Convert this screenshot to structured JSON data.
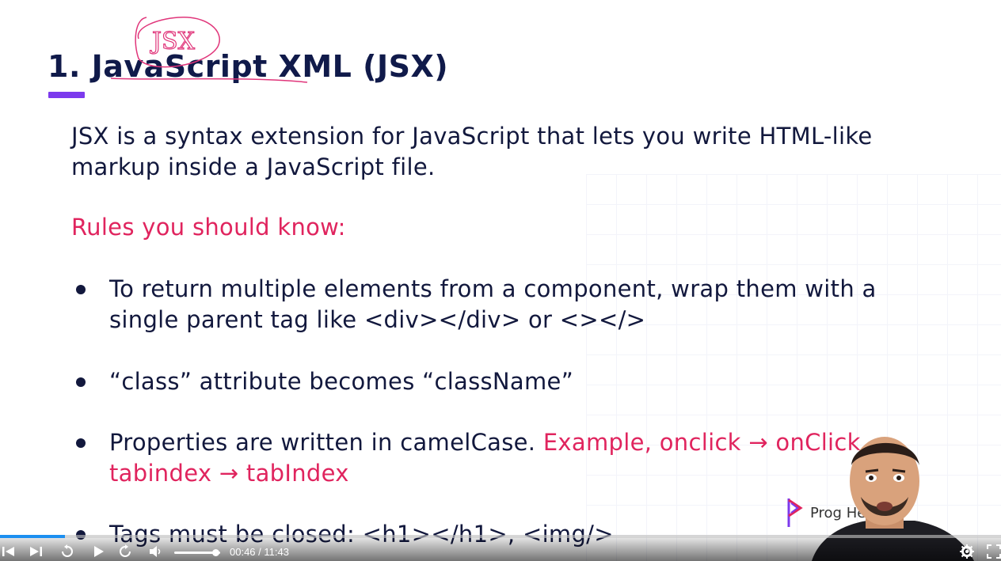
{
  "slide": {
    "title": "1. JavaScript XML (JSX)",
    "handwritten_note": "JSX",
    "intro": "JSX is a syntax extension for JavaScript that lets you write HTML-like markup inside a JavaScript file.",
    "rules_heading": "Rules you should know:",
    "rules": [
      {
        "text": "To return multiple elements from a component, wrap them with a single parent tag like <div></div> or <></>",
        "highlight": ""
      },
      {
        "text": "“class” attribute becomes “className”",
        "highlight": ""
      },
      {
        "text": "Properties are written in camelCase. ",
        "highlight": "Example, onclick → onClick, tabindex → tabIndex"
      },
      {
        "text": "Tags must be closed: <h1></h1>, <img/>",
        "highlight": ""
      }
    ],
    "logo_text": "Prog          Hero"
  },
  "player": {
    "time_label": "00:46 / 11:43",
    "progress_fraction": 0.065,
    "volume_fraction": 0.9
  },
  "colors": {
    "title": "#101a4a",
    "body": "#12183d",
    "accent_pink": "#e0245e",
    "title_underline": "#7c3aed",
    "progress": "#1c8ff0"
  },
  "icons": [
    "skip-back-icon",
    "skip-forward-icon",
    "rewind-icon",
    "play-icon",
    "fast-forward-icon",
    "volume-icon",
    "settings-icon",
    "fullscreen-icon"
  ]
}
